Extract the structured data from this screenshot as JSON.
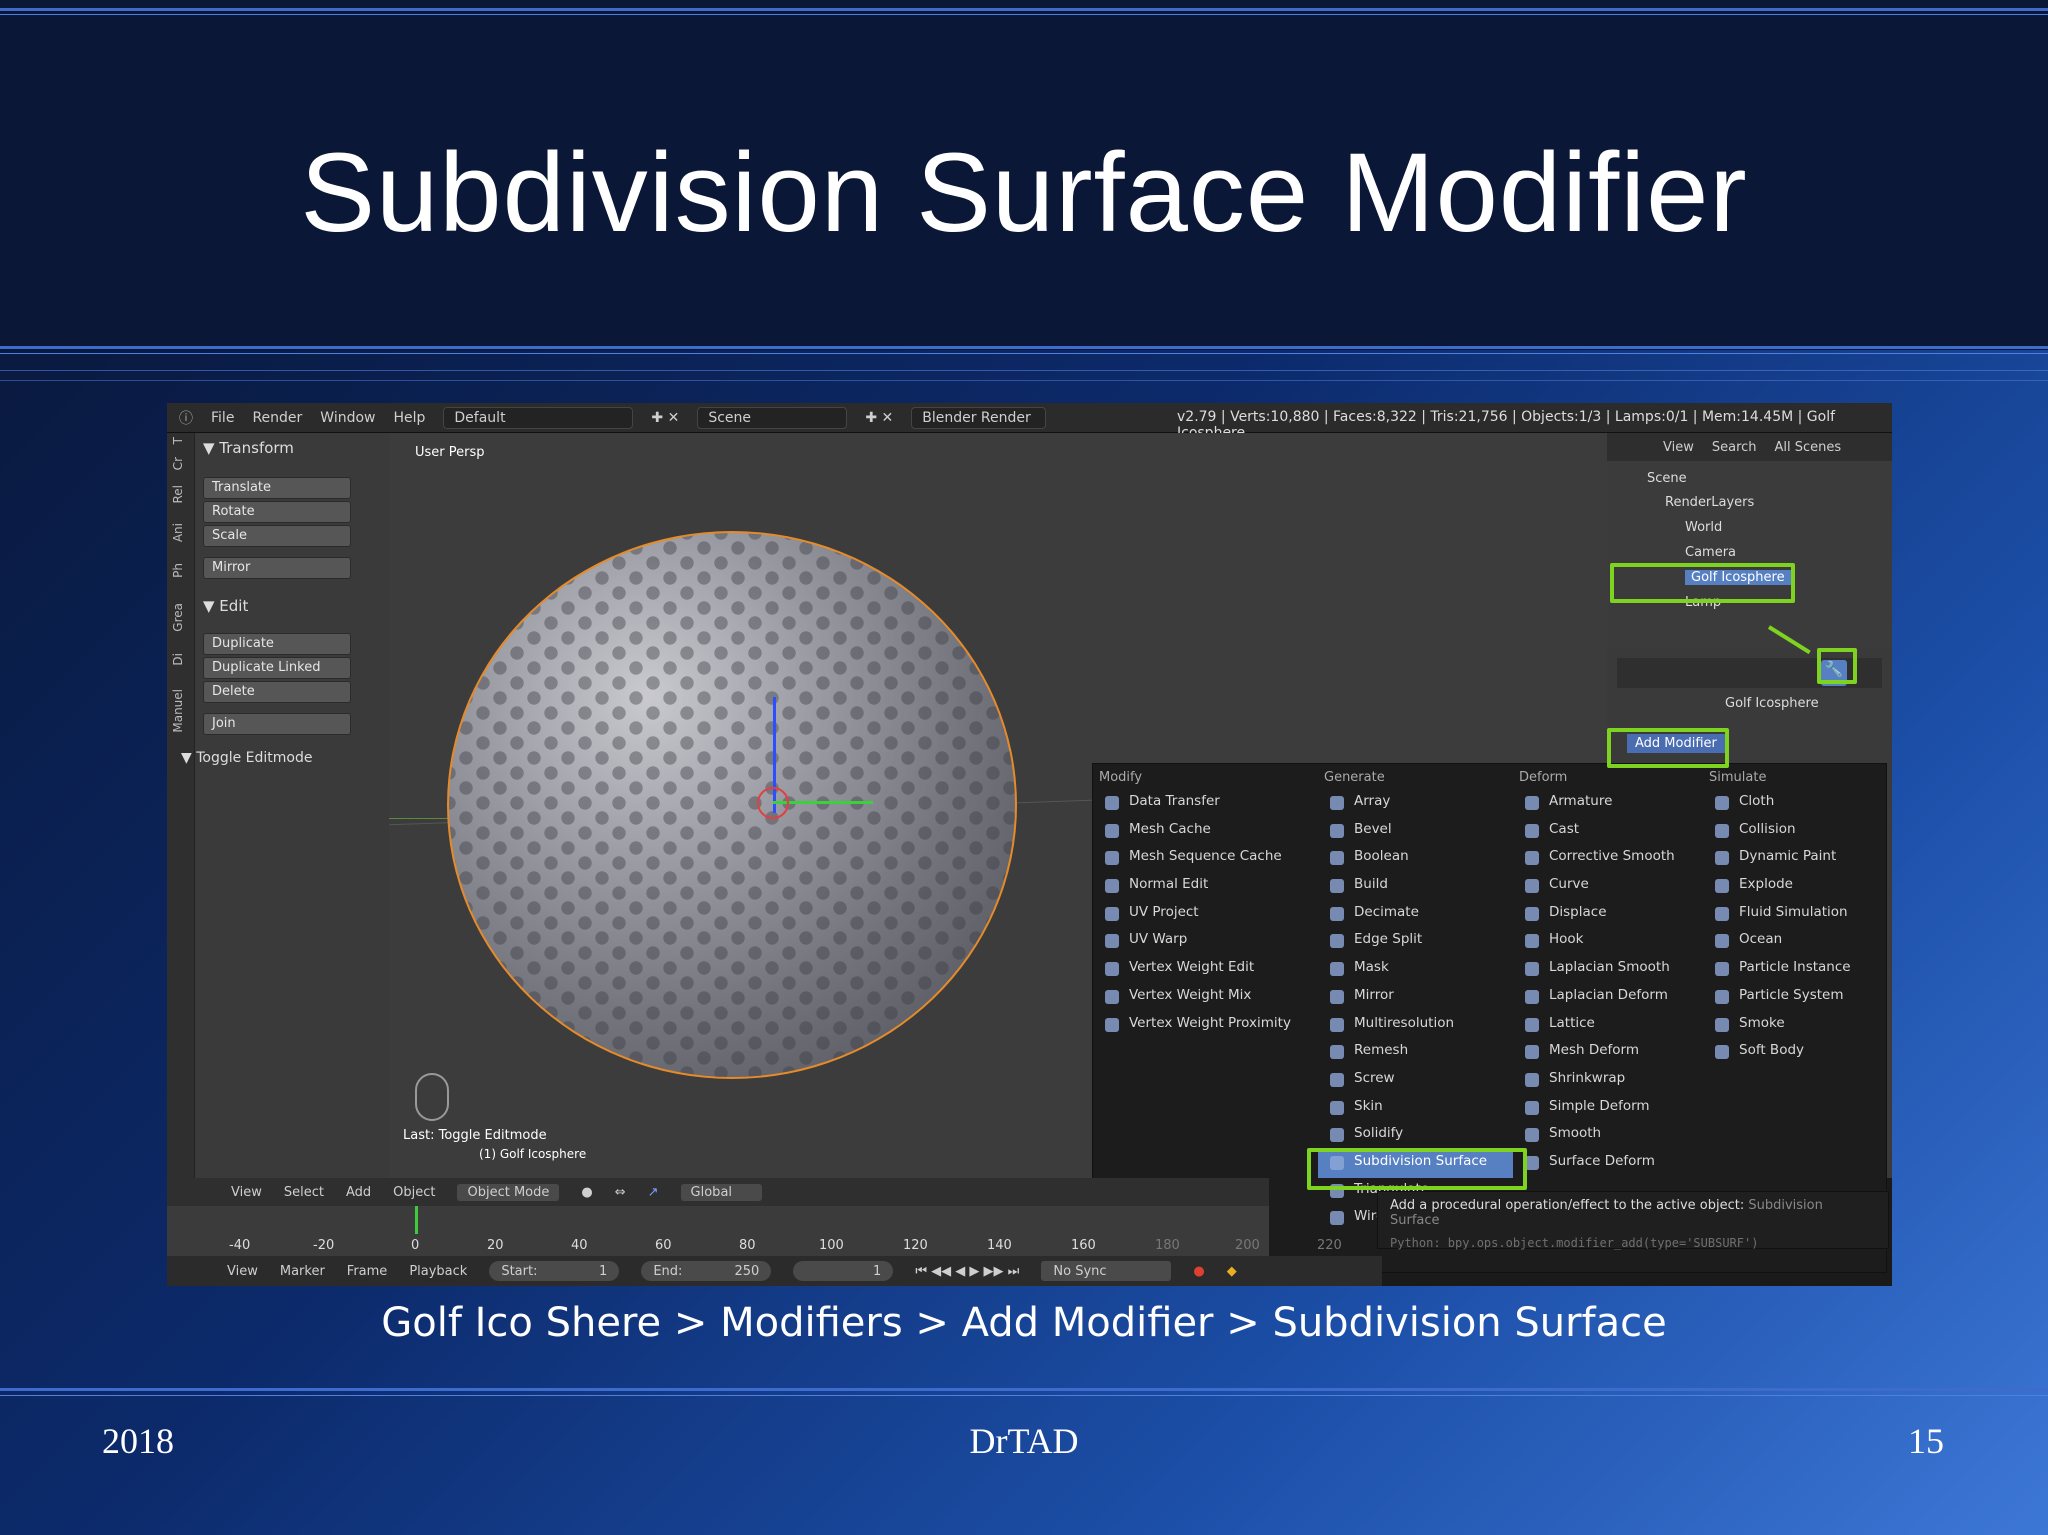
{
  "slide": {
    "title": "Subdivision Surface Modifier",
    "caption": "Golf Ico Shere > Modifiers > Add Modifier > Subdivision Surface",
    "footer_left": "2018",
    "footer_center": "DrTAD",
    "footer_right": "15"
  },
  "blender": {
    "menubar": {
      "items": [
        "File",
        "Render",
        "Window",
        "Help"
      ],
      "layout": "Default",
      "scene": "Scene",
      "engine": "Blender Render",
      "stats": "v2.79 | Verts:10,880 | Faces:8,322 | Tris:21,756 | Objects:1/3 | Lamps:0/1 | Mem:14.45M | Golf Icosphere"
    },
    "toolshelf": {
      "tabs": [
        "T",
        "Cr",
        "Rel",
        "Ani",
        "Ph",
        "Grea",
        "Di",
        "Manuel"
      ],
      "transform_header": "▼ Transform",
      "transform_buttons": [
        "Translate",
        "Rotate",
        "Scale",
        "Mirror"
      ],
      "edit_header": "▼ Edit",
      "edit_buttons": [
        "Duplicate",
        "Duplicate Linked",
        "Delete",
        "Join"
      ],
      "toggle": "▼ Toggle Editmode"
    },
    "viewport": {
      "label": "User Persp",
      "last_op": "Last: Toggle Editmode",
      "object": "(1) Golf Icosphere"
    },
    "outliner": {
      "tabs": [
        "View",
        "Search",
        "All Scenes"
      ],
      "rows": [
        "Scene",
        "RenderLayers",
        "World",
        "Camera",
        "Golf Icosphere",
        "Lamp"
      ]
    },
    "properties": {
      "object": "Golf Icosphere",
      "add_modifier": "Add Modifier"
    },
    "modifier_menu": {
      "columns": [
        {
          "header": "Modify",
          "items": [
            "Data Transfer",
            "Mesh Cache",
            "Mesh Sequence Cache",
            "Normal Edit",
            "UV Project",
            "UV Warp",
            "Vertex Weight Edit",
            "Vertex Weight Mix",
            "Vertex Weight Proximity"
          ]
        },
        {
          "header": "Generate",
          "items": [
            "Array",
            "Bevel",
            "Boolean",
            "Build",
            "Decimate",
            "Edge Split",
            "Mask",
            "Mirror",
            "Multiresolution",
            "Remesh",
            "Screw",
            "Skin",
            "Solidify",
            "Subdivision Surface",
            "Triangulate",
            "Wireframe"
          ]
        },
        {
          "header": "Deform",
          "items": [
            "Armature",
            "Cast",
            "Corrective Smooth",
            "Curve",
            "Displace",
            "Hook",
            "Laplacian Smooth",
            "Laplacian Deform",
            "Lattice",
            "Mesh Deform",
            "Shrinkwrap",
            "Simple Deform",
            "Smooth",
            "Surface Deform"
          ]
        },
        {
          "header": "Simulate",
          "items": [
            "Cloth",
            "Collision",
            "Dynamic Paint",
            "Explode",
            "Fluid Simulation",
            "Ocean",
            "Particle Instance",
            "Particle System",
            "Smoke",
            "Soft Body"
          ]
        }
      ],
      "selected": "Subdivision Surface"
    },
    "tooltip": {
      "text": "Add a procedural operation/effect to the active object:",
      "value": "Subdivision Surface",
      "python": "Python: bpy.ops.object.modifier_add(type='SUBSURF')"
    },
    "viewport_header": {
      "items": [
        "View",
        "Select",
        "Add",
        "Object"
      ],
      "mode": "Object Mode",
      "orientation": "Global"
    },
    "timeline": {
      "ticks": [
        "-40",
        "-20",
        "0",
        "20",
        "40",
        "60",
        "80",
        "100",
        "120",
        "140",
        "160",
        "180",
        "200",
        "220"
      ],
      "menu": [
        "View",
        "Marker",
        "Frame",
        "Playback"
      ],
      "start": "Start:",
      "start_val": "1",
      "end": "End:",
      "end_val": "250",
      "current": "1",
      "sync": "No Sync"
    },
    "highlight_color": "#7ed321"
  }
}
